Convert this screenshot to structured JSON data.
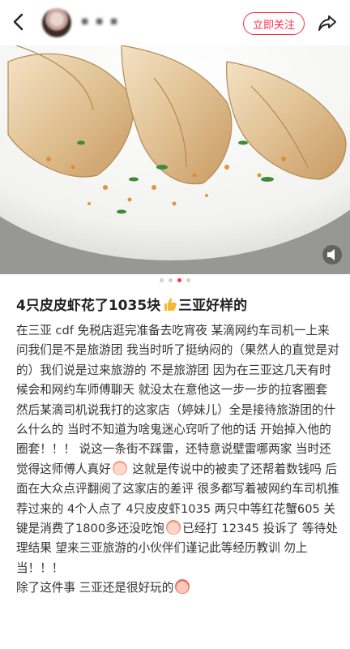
{
  "header": {
    "username": "▪ ▪ ▪",
    "follow_label": "立即关注"
  },
  "gallery": {
    "current": 3,
    "total": 4
  },
  "post": {
    "title": "4只皮皮虾花了1035块",
    "title_suffix": "三亚好样的",
    "body_1": "在三亚 cdf 免税店逛完准备去吃宵夜 某滴网约车司机一上来问我们是不是旅游团 我当时听了挺纳闷的（果然人的直觉是对的）我们说是过来旅游的 不是旅游团 因为在三亚这几天有时候会和网约车师傅聊天 就没太在意他这一步一步的拉客圈套 然后某滴司机说我打的这家店（婷妹儿）全是接待旅游团的什么什么的 当时不知道为啥鬼迷心窍听了他的话 开始掉入他的圈套！！！ 说这一条街不踩雷，还特意说壁雷哪两家 当时还觉得这师傅人真好",
    "body_2": " 这就是传说中的被卖了还帮着数钱吗 后面在大众点评翻阅了这家店的差评 很多都写着被网约车司机推荐过来的 4个人点了 4只皮皮虾1035 两只中等红花蟹605 关键是消费了1800多还没吃饱",
    "body_3": "已经打 12345 投诉了 等待处理结果 望来三亚旅游的小伙伴们谨记此等经历教训 勿上当！！！",
    "body_4": "除了这件事 三亚还是很好玩的"
  }
}
